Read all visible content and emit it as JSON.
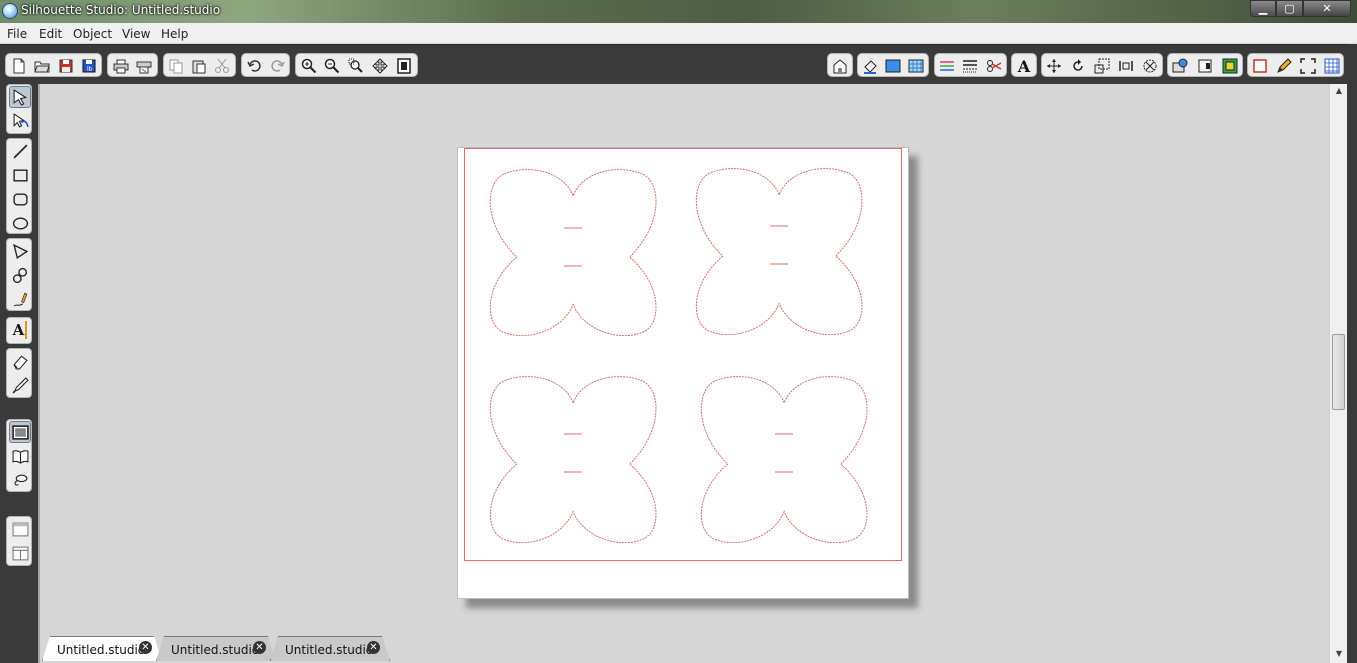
{
  "window": {
    "title": "Silhouette Studio: Untitled.studio",
    "app_icon": "globe-icon"
  },
  "window_controls": {
    "minimize": "▁",
    "maximize": "▢",
    "close": "✕"
  },
  "menu": [
    "File",
    "Edit",
    "Object",
    "View",
    "Help"
  ],
  "colors": {
    "cut_line": "#e06a6a",
    "toolbar_bg": "#3a3a3a",
    "canvas_bg": "#d6d6d6"
  },
  "tabs": [
    {
      "label": "Untitled.studio",
      "active": true
    },
    {
      "label": "Untitled.studio",
      "active": false
    },
    {
      "label": "Untitled.studio",
      "active": false
    }
  ],
  "toolbar_text_glyph": "A",
  "left_text_glyph": "A"
}
